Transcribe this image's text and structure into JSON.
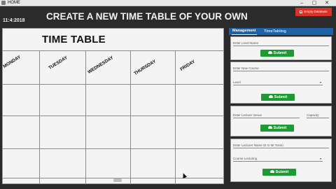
{
  "window": {
    "title": "HOME",
    "minimize_glyph": "–",
    "maximize_glyph": "▢",
    "close_glyph": "✕"
  },
  "header": {
    "heading": "CREATE A NEW TIME TABLE OF YOUR OWN",
    "clock": "11:4:2018",
    "empty_db_label": "Empty Database"
  },
  "timetable": {
    "title": "TIME TABLE",
    "days": [
      "MONDAY",
      "TUESDAY",
      "WEDNESDAY",
      "THURSDAY",
      "FRIDAY"
    ]
  },
  "panel": {
    "tabs": [
      "Management",
      "TimeTabling"
    ],
    "card1": {
      "level_name_placeholder": "Enter Level Name",
      "submit_label": "Submit"
    },
    "card2": {
      "new_course_placeholder": "Enter New Course",
      "level_select": "Level",
      "submit_label": "Submit"
    },
    "card3": {
      "lecture_venue_placeholder": "Enter Lecture Venue",
      "capacity_placeholder": "Capacity",
      "submit_label": "Submit"
    },
    "card4": {
      "lecturer_name_placeholder": "Enter Lecturer Name (E.G Mr.Tosin)",
      "course_select": "Course Lecturing",
      "submit_label": "Submit"
    }
  },
  "colors": {
    "accent_blue": "#1d62a8",
    "submit_green": "#1e9a32",
    "danger_red": "#d8332a"
  }
}
